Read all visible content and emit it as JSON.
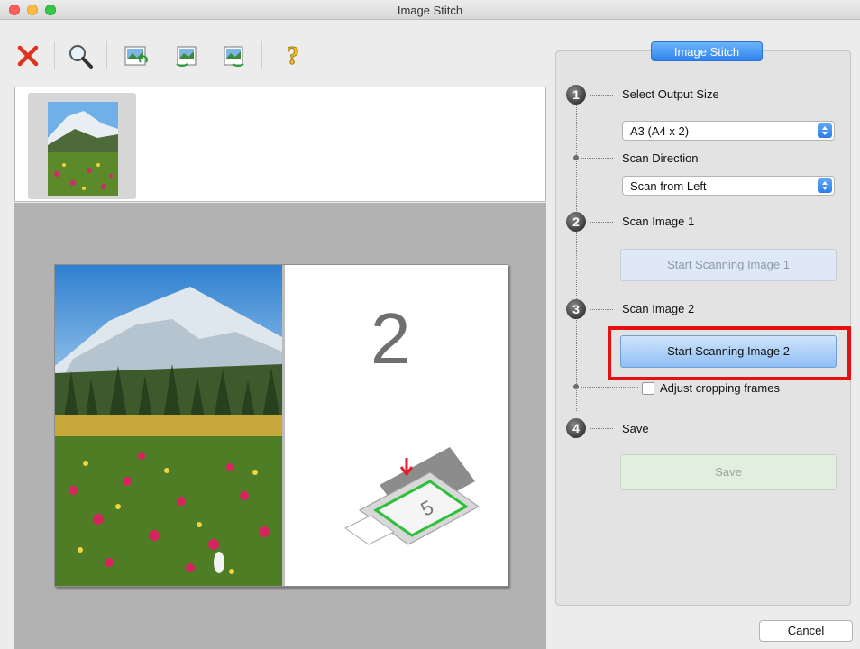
{
  "window": {
    "title": "Image Stitch"
  },
  "toolbar": {
    "icons": [
      "delete-icon",
      "zoom-icon",
      "scan-settings-icon",
      "rotate-icon",
      "rotate-icon-2",
      "help-icon"
    ]
  },
  "preview": {
    "placeholder_number": "2"
  },
  "panel": {
    "tab_label": "Image Stitch",
    "steps": [
      {
        "number": "1",
        "label": "Select Output Size"
      },
      {
        "number": "2",
        "label": "Scan Image 1"
      },
      {
        "number": "3",
        "label": "Scan Image 2"
      },
      {
        "number": "4",
        "label": "Save"
      }
    ],
    "output_size": {
      "value": "A3 (A4 x 2)"
    },
    "scan_direction": {
      "label": "Scan Direction",
      "value": "Scan from Left"
    },
    "start_scan_1_label": "Start Scanning Image 1",
    "start_scan_2_label": "Start Scanning Image 2",
    "adjust_cropping_label": "Adjust cropping frames",
    "adjust_cropping_checked": false,
    "save_label": "Save"
  },
  "footer": {
    "cancel_label": "Cancel"
  },
  "colors": {
    "accent": "#2f84ee",
    "highlight": "#e41111"
  }
}
